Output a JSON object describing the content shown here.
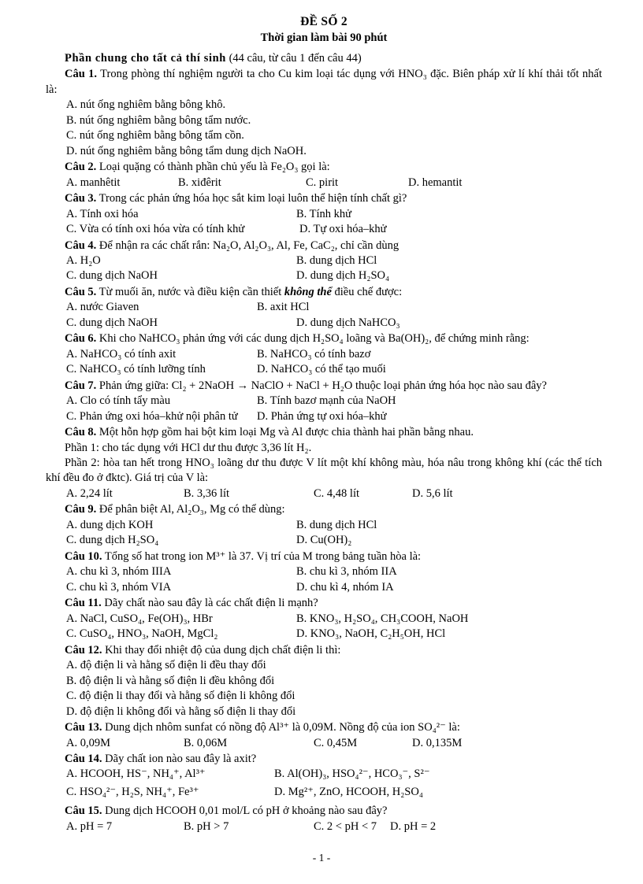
{
  "document": {
    "title": "ĐỀ SỐ 2",
    "subtitle": "Thời gian làm bài 90 phút",
    "section_heading_bold": "Phần chung cho tất cả thí sinh",
    "section_heading_rest": " (44 câu, từ câu 1 đến câu 44)",
    "footer": "- 1 -"
  },
  "questions": [
    {
      "number": "Câu 1.",
      "stem": "Trong phòng thí nghiệm người ta cho Cu kim loại tác dụng với HNO₃ đặc. Biên pháp xử lí khí thải tốt nhất là:",
      "layout": "stacked",
      "options": [
        "A. nút ống nghiêm bằng bông khô.",
        "B. nút ống nghiêm bằng bông tẩm nước.",
        "C. nút ống nghiêm bằng bông tẩm cồn.",
        "D. nút ống nghiêm bằng bông tẩm dung dịch NaOH."
      ]
    },
    {
      "number": "Câu 2.",
      "stem": "Loại quặng có thành phần chủ yếu là Fe₂O₃ gọi là:",
      "layout": "four-column",
      "options": [
        "A. manhêtit",
        "B. xiđêrit",
        "C. pirit",
        "D. hemantit"
      ]
    },
    {
      "number": "Câu 3.",
      "stem": "Trong các phản ứng hóa học sắt kim loại luôn thể hiện tính chất gì?",
      "layout": "two-column",
      "options": [
        "A. Tính oxi hóa",
        "B. Tính khử",
        "C. Vừa có tính oxi hóa vừa có tính khử",
        "D. Tự oxi hóa–khử"
      ]
    },
    {
      "number": "Câu 4.",
      "stem": "Để nhận ra các chất rắn: Na₂O, Al₂O₃, Al, Fe, CaC₂, chỉ cần dùng",
      "layout": "two-column",
      "options": [
        "A. H₂O",
        "B. dung dịch HCl",
        "C. dung dịch NaOH",
        "D. dung dịch H₂SO₄"
      ]
    },
    {
      "number": "Câu 5.",
      "stem_pre": "Từ muối ăn, nước và điều kiện cần thiết ",
      "stem_italic": "không thể",
      "stem_post": " điều chế được:",
      "layout": "two-column",
      "options": [
        "A. nước Giaven",
        "B. axit HCl",
        "C. dung dịch NaOH",
        "D. dung dịch NaHCO₃"
      ]
    },
    {
      "number": "Câu 6.",
      "stem": "Khi cho NaHCO₃ phản ứng với các dung dịch H₂SO₄ loãng và Ba(OH)₂, để chứng minh rằng:",
      "layout": "two-column",
      "options": [
        "A. NaHCO₃ có tính axit",
        "B. NaHCO₃ có tính bazơ",
        "C. NaHCO₃ có tính lưỡng tính",
        "D. NaHCO₃ có thể tạo muối"
      ]
    },
    {
      "number": "Câu 7.",
      "stem": "Phản ứng giữa: Cl₂ + 2NaOH → NaClO + NaCl + H₂O thuộc loại phản ứng hóa học nào sau đây?",
      "layout": "two-column",
      "options": [
        "A. Clo có tính tẩy màu",
        "B. Tính bazơ mạnh của NaOH",
        "C. Phản ứng oxi hóa–khử nội phân tử",
        "D. Phản ứng tự oxi hóa–khử"
      ]
    },
    {
      "number": "Câu 8.",
      "stem": "Một hỗn hợp gồm hai bột kim loại Mg và Al được chia thành hai phần bằng nhau.",
      "extra_lines": [
        "Phần 1: cho tác dụng với HCl dư thu được 3,36 lít H₂.",
        "Phần 2: hòa tan hết trong HNO₃ loãng dư thu được V lít một khí không màu, hóa nâu trong không khí (các thể tích khí đều đo ở đktc). Giá trị của V là:"
      ],
      "layout": "four-column",
      "options": [
        "A. 2,24 lít",
        "B. 3,36 lít",
        "C. 4,48 lít",
        "D. 5,6 lít"
      ]
    },
    {
      "number": "Câu 9.",
      "stem": "Để phân biệt Al, Al₂O₃, Mg có thể dùng:",
      "layout": "two-column",
      "options": [
        "A. dung dịch KOH",
        "B. dung dịch HCl",
        "C. dung dịch H₂SO₄",
        "D. Cu(OH)₂"
      ]
    },
    {
      "number": "Câu 10.",
      "stem": "Tổng số hat trong ion M³⁺ là 37. Vị trí của M trong bảng tuần hòa là:",
      "layout": "two-column",
      "options": [
        "A. chu kì 3, nhóm IIIA",
        "B. chu kì 3, nhóm IIA",
        "C. chu kì 3, nhóm VIA",
        "D. chu kì 4, nhóm IA"
      ]
    },
    {
      "number": "Câu 11.",
      "stem": "Dãy chất nào sau đây là các chất điện li mạnh?",
      "layout": "two-column",
      "options": [
        "A. NaCl, CuSO₄, Fe(OH)₃, HBr",
        "B. KNO₃, H₂SO₄, CH₃COOH, NaOH",
        "C. CuSO₄, HNO₃, NaOH, MgCl₂",
        "D. KNO₃, NaOH, C₂H₅OH, HCl"
      ]
    },
    {
      "number": "Câu 12.",
      "stem": "Khi thay đổi nhiệt độ của dung dịch chất điện li thì:",
      "layout": "stacked",
      "options": [
        "A. độ điện li và hằng số điện li đều thay đổi",
        "B. độ điện li và hằng số điện li đều không đổi",
        "C. độ điện li thay đổi và hằng số điện li không đổi",
        "D. độ điện li không đổi và hằng số điện li thay đổi"
      ]
    },
    {
      "number": "Câu 13.",
      "stem": "Dung dịch nhôm sunfat có nồng độ Al³⁺ là 0,09M. Nồng độ của ion SO₄²⁻ là:",
      "layout": "four-column",
      "options": [
        "A. 0,09M",
        "B. 0,06M",
        "C. 0,45M",
        "D. 0,135M"
      ]
    },
    {
      "number": "Câu 14.",
      "stem": "Dãy chất ion nào sau đây là axit?",
      "layout": "two-column",
      "options": [
        "A. HCOOH, HS⁻, NH₄⁺, Al³⁺",
        "B. Al(OH)₃, HSO₄²⁻, HCO₃⁻, S²⁻",
        "C. HSO₄²⁻, H₂S, NH₄⁺, Fe³⁺",
        "D. Mg²⁺, ZnO, HCOOH, H₂SO₄"
      ]
    },
    {
      "number": "Câu 15.",
      "stem": "Dung dịch HCOOH 0,01 mol/L có pH ở khoảng nào sau đây?",
      "layout": "four-column",
      "options": [
        "A. pH = 7",
        "B. pH > 7",
        "C. 2 < pH < 7",
        "D. pH = 2"
      ]
    }
  ]
}
